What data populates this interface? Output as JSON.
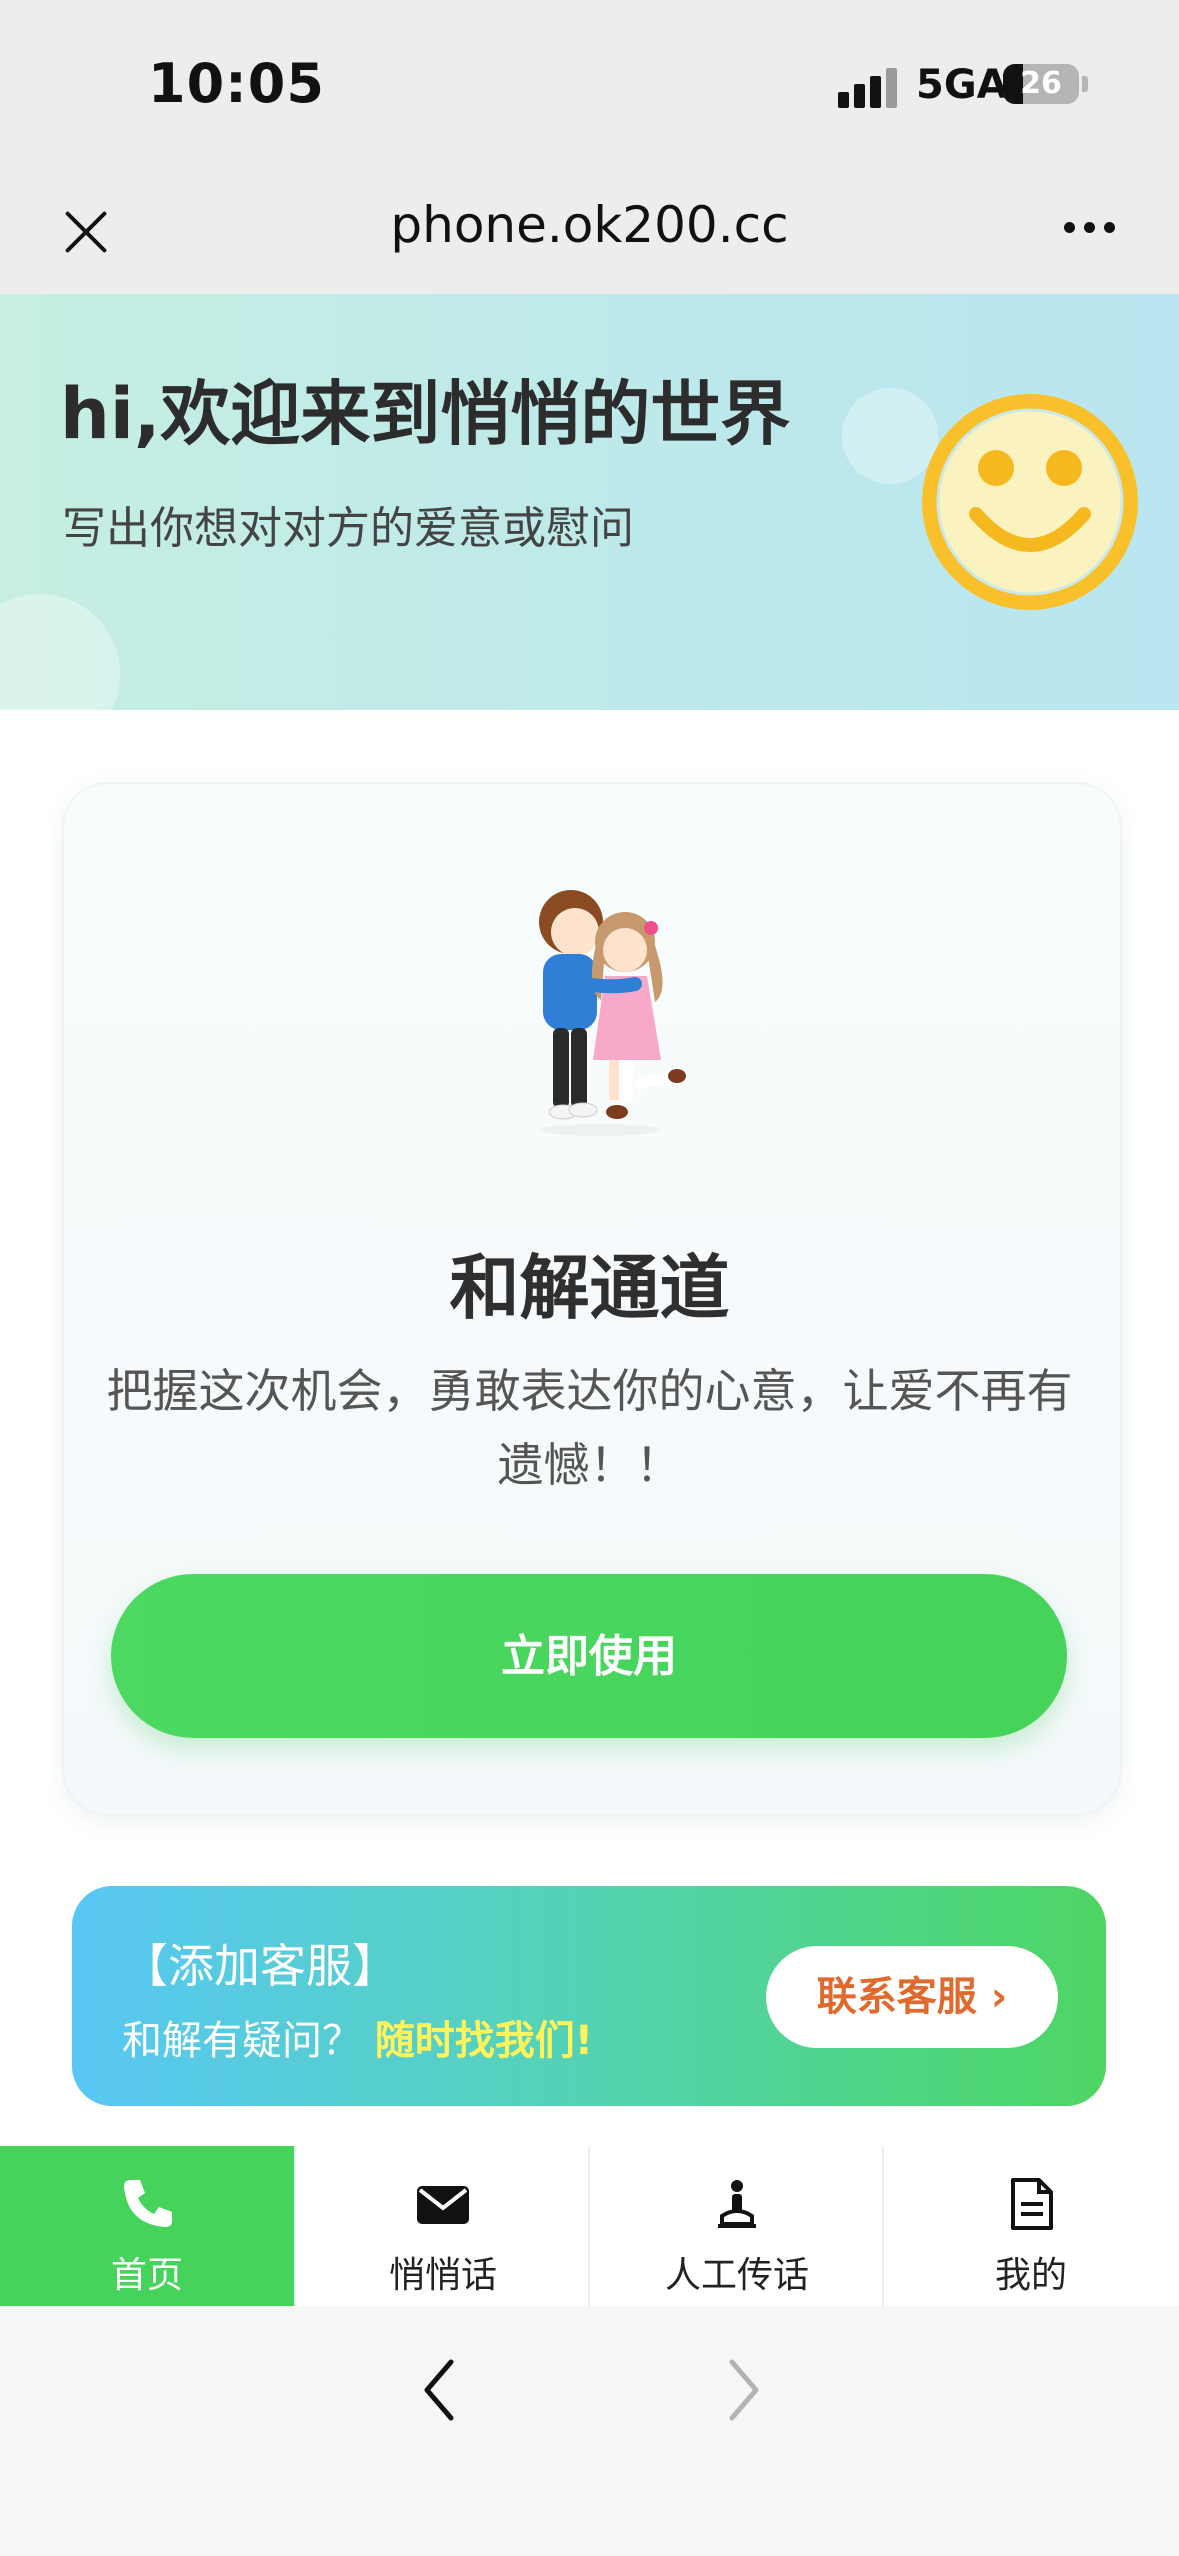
{
  "status_bar": {
    "time": "10:05",
    "network": "5GA",
    "battery": "26",
    "battery_level": 0.26
  },
  "nav": {
    "title": "phone.ok200.cc",
    "close_icon": "close-icon",
    "more_icon": "more-icon"
  },
  "hero": {
    "title": "hi,欢迎来到悄悄的世界",
    "subtitle": "写出你想对对方的爱意或慰问",
    "icon": "smiley-icon"
  },
  "card": {
    "title": "和解通道",
    "description": "把握这次机会，勇敢表达你的心意，让爱不再有遗憾！！",
    "button_label": "立即使用",
    "illustration": "couple-hug-illustration"
  },
  "service": {
    "title": "【添加客服】",
    "subtitle_prefix": "和解有疑问？",
    "subtitle_highlight": "随时找我们",
    "subtitle_suffix": "!",
    "button_label": "联系客服 ›"
  },
  "tabbar": {
    "items": [
      {
        "label": "首页",
        "icon": "phone-icon",
        "active": true
      },
      {
        "label": "悄悄话",
        "icon": "mail-icon",
        "active": false
      },
      {
        "label": "人工传话",
        "icon": "person-icon",
        "active": false
      },
      {
        "label": "我的",
        "icon": "document-icon",
        "active": false
      }
    ]
  },
  "browser_nav": {
    "back_icon": "chevron-left-icon",
    "forward_icon": "chevron-right-icon"
  },
  "colors": {
    "accent_green": "#46d35b",
    "service_orange": "#e06a2e",
    "highlight_yellow": "#fff25a"
  }
}
